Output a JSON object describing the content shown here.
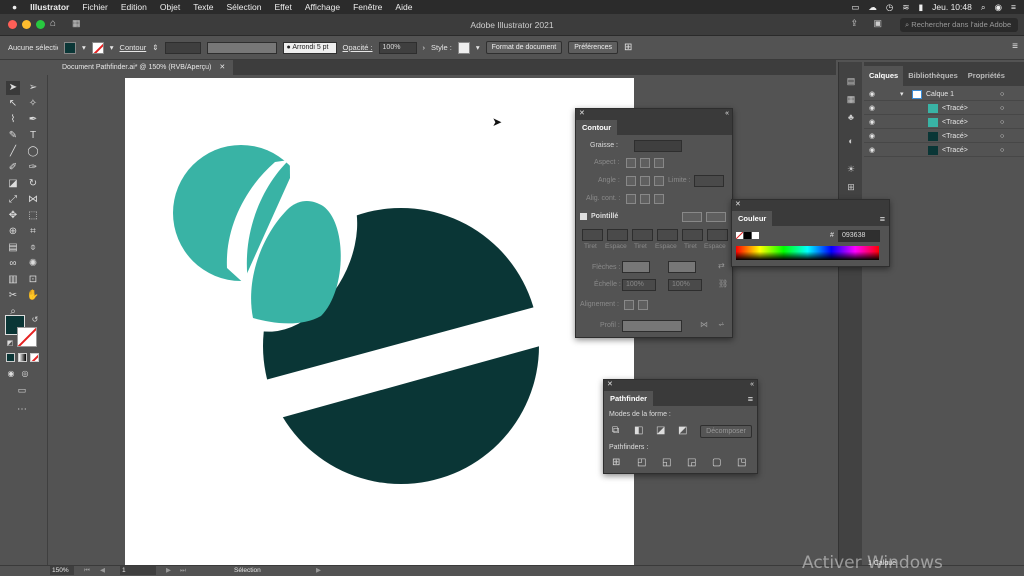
{
  "menubar": {
    "apple": "",
    "items": [
      "Illustrator",
      "Fichier",
      "Edition",
      "Objet",
      "Texte",
      "Sélection",
      "Effet",
      "Affichage",
      "Fenêtre",
      "Aide"
    ],
    "clock": "Jeu. 10:48"
  },
  "window": {
    "title": "Adobe Illustrator 2021",
    "help_placeholder": "Rechercher dans l'aide Adobe"
  },
  "control_bar": {
    "selection_label": "Aucune sélection",
    "stroke_label": "Contour",
    "brush_label": "Arrondi 5 pt",
    "opacity_label": "Opacité :",
    "opacity_value": "100%",
    "style_label": "Style :",
    "doc_format_button": "Format de document",
    "preferences_button": "Préférences"
  },
  "document_tab": "Document Pathfinder.ai* @ 150% (RVB/Aperçu)",
  "colors": {
    "teal": "#39B3A5",
    "dark_teal": "#0A3636",
    "ui_bg": "#535353"
  },
  "stroke_panel": {
    "title": "Contour",
    "weight_label": "Graisse :",
    "cap_label": "Aspect :",
    "corner_label": "Angle :",
    "limit_label": "Limite :",
    "align_label": "Alig. cont. :",
    "dashed_label": "Pointillé",
    "dash_cols": [
      "Tiret",
      "Espace",
      "Tiret",
      "Espace",
      "Tiret",
      "Espace"
    ],
    "arrows_label": "Flèches :",
    "scale_label": "Échelle :",
    "scale_values": [
      "100%",
      "100%"
    ],
    "align2_label": "Alignement :",
    "profile_label": "Profil :"
  },
  "color_panel": {
    "title": "Couleur",
    "hex_prefix": "#",
    "hex_value": "093638"
  },
  "pathfinder_panel": {
    "title": "Pathfinder",
    "shape_modes_label": "Modes de la forme :",
    "expand_button": "Décomposer",
    "pathfinders_label": "Pathfinders :"
  },
  "layers_panel": {
    "tabs": [
      "Calques",
      "Bibliothèques",
      "Propriétés"
    ],
    "layer_name": "Calque 1",
    "items": [
      "<Tracé>",
      "<Tracé>",
      "<Tracé>",
      "<Tracé>"
    ]
  },
  "status_bar": {
    "zoom": "150%",
    "page": "1",
    "mode": "Sélection",
    "layers_count": "1 Calque"
  },
  "watermark": "Activer Windows"
}
